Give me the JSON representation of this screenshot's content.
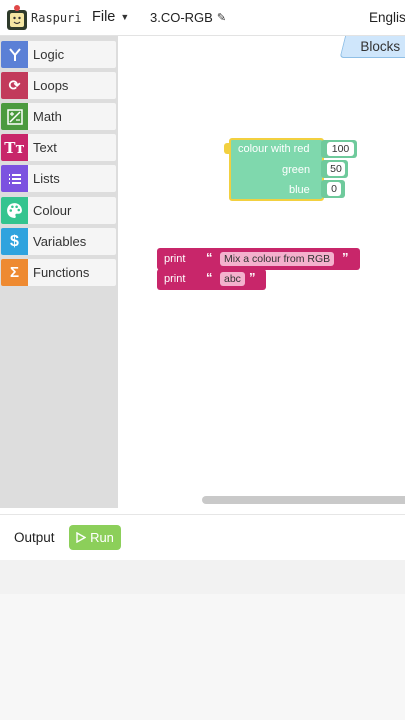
{
  "header": {
    "brand": "Raspuri",
    "file_menu": "File",
    "project_name": "3.CO-RGB",
    "language": "English"
  },
  "toolbox": {
    "categories": [
      {
        "label": "Logic",
        "color": "#5b80d6",
        "icon": "logic-icon"
      },
      {
        "label": "Loops",
        "color": "#c23a5b",
        "icon": "loop-icon"
      },
      {
        "label": "Math",
        "color": "#4b9a3f",
        "icon": "math-icon"
      },
      {
        "label": "Text",
        "color": "#c8266a",
        "icon": "text-icon"
      },
      {
        "label": "Lists",
        "color": "#7c52e0",
        "icon": "list-icon"
      },
      {
        "label": "Colour",
        "color": "#34c48f",
        "icon": "palette-icon"
      },
      {
        "label": "Variables",
        "color": "#2fa3de",
        "icon": "dollar-icon"
      },
      {
        "label": "Functions",
        "color": "#ee8a31",
        "icon": "sigma-icon"
      }
    ]
  },
  "workspace": {
    "blocks_tab": "Blocks",
    "colour_block": {
      "label_red": "colour with red",
      "label_green": "green",
      "label_blue": "blue",
      "red": "100",
      "green": "50",
      "blue": "0"
    },
    "print_blocks": [
      {
        "label": "print",
        "value": "Mix a colour from RGB"
      },
      {
        "label": "print",
        "value": "abc"
      }
    ]
  },
  "output": {
    "label": "Output",
    "run_label": "Run"
  },
  "colors": {
    "accent_run": "#8ccf5a",
    "colour_block": "#7fd8ad",
    "text_block": "#c8266a"
  }
}
